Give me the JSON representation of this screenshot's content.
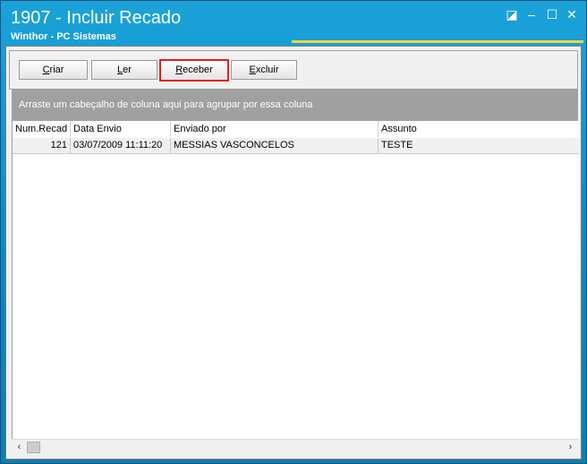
{
  "window": {
    "title": "1907 - Incluir Recado",
    "subtitle": "Winthor - PC Sistemas",
    "controls": {
      "restore": "◪",
      "minimize": "–",
      "maximize": "☐",
      "close": "✕"
    }
  },
  "toolbar": {
    "buttons": [
      {
        "first": "C",
        "rest": "riar"
      },
      {
        "first": "L",
        "rest": "er"
      },
      {
        "first": "R",
        "rest": "eceber"
      },
      {
        "first": "E",
        "rest": "xcluir"
      }
    ]
  },
  "grid": {
    "group_hint": "Arraste um cabeçalho de coluna aqui para agrupar por essa coluna",
    "columns": [
      "Num.Recad",
      "Data Envio",
      "Enviado por",
      "Assunto"
    ],
    "rows": [
      [
        "121",
        "03/07/2009 11:11:20",
        "MESSIAS VASCONCELOS",
        "TESTE"
      ]
    ]
  },
  "scrollbar": {
    "left": "‹",
    "right": "›"
  }
}
